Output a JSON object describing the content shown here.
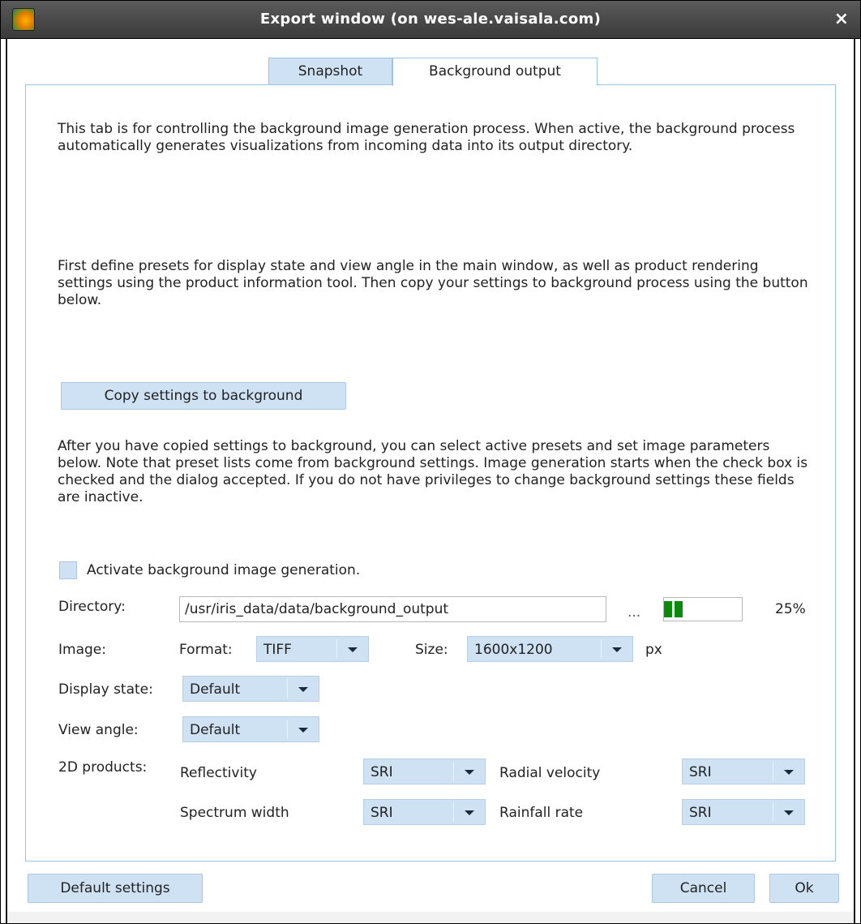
{
  "window": {
    "title": "Export window (on wes-ale.vaisala.com)",
    "icon": "app-icon",
    "close": "×"
  },
  "tabs": [
    {
      "label": "Snapshot",
      "active": false
    },
    {
      "label": "Background output",
      "active": true
    }
  ],
  "content": {
    "intro": "This tab is for controlling the background image generation process. When active, the background process automatically generates visualizations from incoming data into its output directory.",
    "presets_help": "First define presets for display state and view angle in the main window, as well as product rendering settings using the product information tool. Then copy your settings to background process using the button below.",
    "copy_button": "Copy settings to background",
    "after_copy_help": "After you have copied settings to background, you can select active presets and set image parameters below.  Note that preset lists come from background settings. Image generation starts when the check box is checked and the dialog accepted.  If you do not have privileges to change background settings these fields are inactive.",
    "activate_label": "Activate background image generation.",
    "activate_checked": false
  },
  "directory": {
    "label": "Directory:",
    "value": "/usr/iris_data/data/background_output",
    "browse": "...",
    "progress_percent": 25,
    "progress_text": "25%",
    "progress_color": "#0b8a0b"
  },
  "image": {
    "label": "Image:",
    "format_label": "Format:",
    "format_value": "TIFF",
    "size_label": "Size:",
    "size_value": "1600x1200",
    "unit": "px"
  },
  "display_state": {
    "label": "Display state:",
    "value": "Default"
  },
  "view_angle": {
    "label": "View angle:",
    "value": "Default"
  },
  "products": {
    "label": "2D products:",
    "items": [
      {
        "name": "Reflectivity",
        "value": "SRI"
      },
      {
        "name": "Radial velocity",
        "value": "SRI"
      },
      {
        "name": "Spectrum width",
        "value": "SRI"
      },
      {
        "name": "Rainfall rate",
        "value": "SRI"
      }
    ]
  },
  "footer": {
    "default_button": "Default settings",
    "cancel_button": "Cancel",
    "ok_button": "Ok"
  },
  "colors": {
    "accent": "#cfe2f3",
    "border": "#9cc3e3",
    "titlebar": "#3a3a3a"
  }
}
